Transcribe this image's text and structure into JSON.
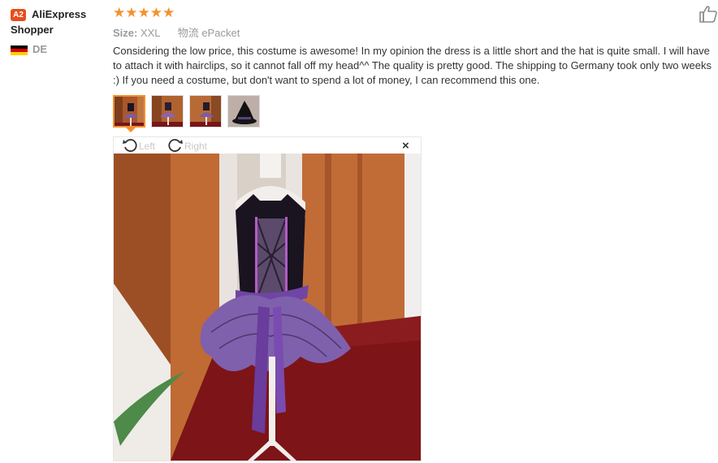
{
  "reviewer": {
    "avatar_badge": "A2",
    "name": "AliExpress Shopper",
    "country_code": "DE",
    "flag_colors": [
      "#000000",
      "#dd0000",
      "#ffce00"
    ]
  },
  "rating": {
    "stars": 5,
    "max": 5,
    "star_glyphs": "★★★★★",
    "color": "#f4912e"
  },
  "attributes": {
    "size_label": "Size:",
    "size_value": "XXL",
    "shipping_label": "物流",
    "shipping_value": "ePacket"
  },
  "helpful_icon": "thumbs-up-icon",
  "review_text": "Considering the low price, this costume is awesome! In my opinion the dress is a little short and the hat is quite small. I will have to attach it with hairclips, so it cannot fall off my head^^ The quality is pretty good. The shipping to Germany took only two weeks :) If you need a costume, but don't want to spend a lot of money, I can recommend this one.",
  "photos": {
    "thumbnails": [
      "dress-front",
      "dress-back",
      "dress-side",
      "witch-hat"
    ],
    "selected_index": 0
  },
  "viewer": {
    "rotate_left_label": "Left",
    "rotate_right_label": "Right",
    "close_glyph": "×"
  },
  "colors": {
    "accent": "#f4912e",
    "badge": "#e64e1c",
    "muted_text": "#9a9a9a"
  }
}
